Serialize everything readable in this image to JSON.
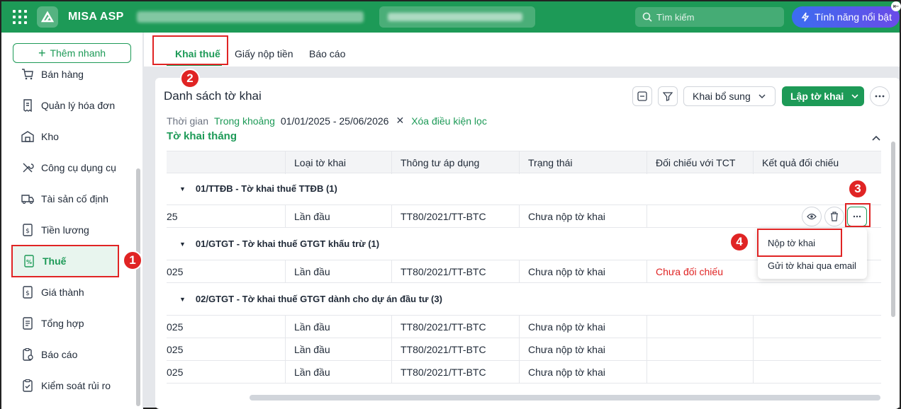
{
  "app": {
    "name": "MISA ASP",
    "search_placeholder": "Tìm kiếm",
    "feature_button": "Tính năng nổi bật"
  },
  "sidebar": {
    "quick_add": "Thêm nhanh",
    "items": [
      {
        "label": "Bán hàng"
      },
      {
        "label": "Quản lý hóa đơn"
      },
      {
        "label": "Kho"
      },
      {
        "label": "Công cụ dụng cụ"
      },
      {
        "label": "Tài sản cố định"
      },
      {
        "label": "Tiền lương"
      },
      {
        "label": "Thuế"
      },
      {
        "label": "Giá thành"
      },
      {
        "label": "Tổng hợp"
      },
      {
        "label": "Báo cáo"
      },
      {
        "label": "Kiểm soát rủi ro"
      }
    ]
  },
  "tabs": [
    {
      "label": "Khai thuế"
    },
    {
      "label": "Giấy nộp tiền"
    },
    {
      "label": "Báo cáo"
    }
  ],
  "panel": {
    "title": "Danh sách tờ khai",
    "supplement_button": "Khai bổ sung",
    "create_button": "Lập tờ khai",
    "filter": {
      "field": "Thời gian",
      "operator": "Trong khoảng",
      "value": "01/01/2025 - 25/06/2026",
      "clear": "Xóa điều kiện lọc"
    },
    "section_title": "Tờ khai tháng"
  },
  "table": {
    "headers": [
      "Loại tờ khai",
      "Thông tư áp dụng",
      "Trạng thái",
      "Đối chiếu với TCT",
      "Kết quả đối chiếu"
    ],
    "groups": [
      {
        "title": "01/TTĐB - Tờ khai thuế TTĐB (1)"
      },
      {
        "title": "01/GTGT - Tờ khai thuế GTGT khấu trừ (1)"
      },
      {
        "title": "02/GTGT - Tờ khai thuế GTGT dành cho dự án đầu tư (3)"
      }
    ],
    "rows": [
      {
        "period": "25",
        "type": "Lần đầu",
        "circular": "TT80/2021/TT-BTC",
        "status": "Chưa nộp tờ khai",
        "reconcile": ""
      },
      {
        "period": "025",
        "type": "Lần đầu",
        "circular": "TT80/2021/TT-BTC",
        "status": "Chưa nộp tờ khai",
        "reconcile": "Chưa đối chiếu"
      },
      {
        "period": "025",
        "type": "Lần đầu",
        "circular": "TT80/2021/TT-BTC",
        "status": "Chưa nộp tờ khai",
        "reconcile": ""
      },
      {
        "period": "025",
        "type": "Lần đầu",
        "circular": "TT80/2021/TT-BTC",
        "status": "Chưa nộp tờ khai",
        "reconcile": ""
      },
      {
        "period": "025",
        "type": "Lần đầu",
        "circular": "TT80/2021/TT-BTC",
        "status": "Chưa nộp tờ khai",
        "reconcile": ""
      }
    ]
  },
  "context_menu": {
    "items": [
      {
        "label": "Nộp tờ khai"
      },
      {
        "label": "Gửi tờ khai qua email"
      }
    ]
  },
  "annotations": {
    "badges": [
      "1",
      "2",
      "3",
      "4"
    ]
  },
  "colors": {
    "brand": "#1d9a57",
    "annotation": "#e02424"
  }
}
